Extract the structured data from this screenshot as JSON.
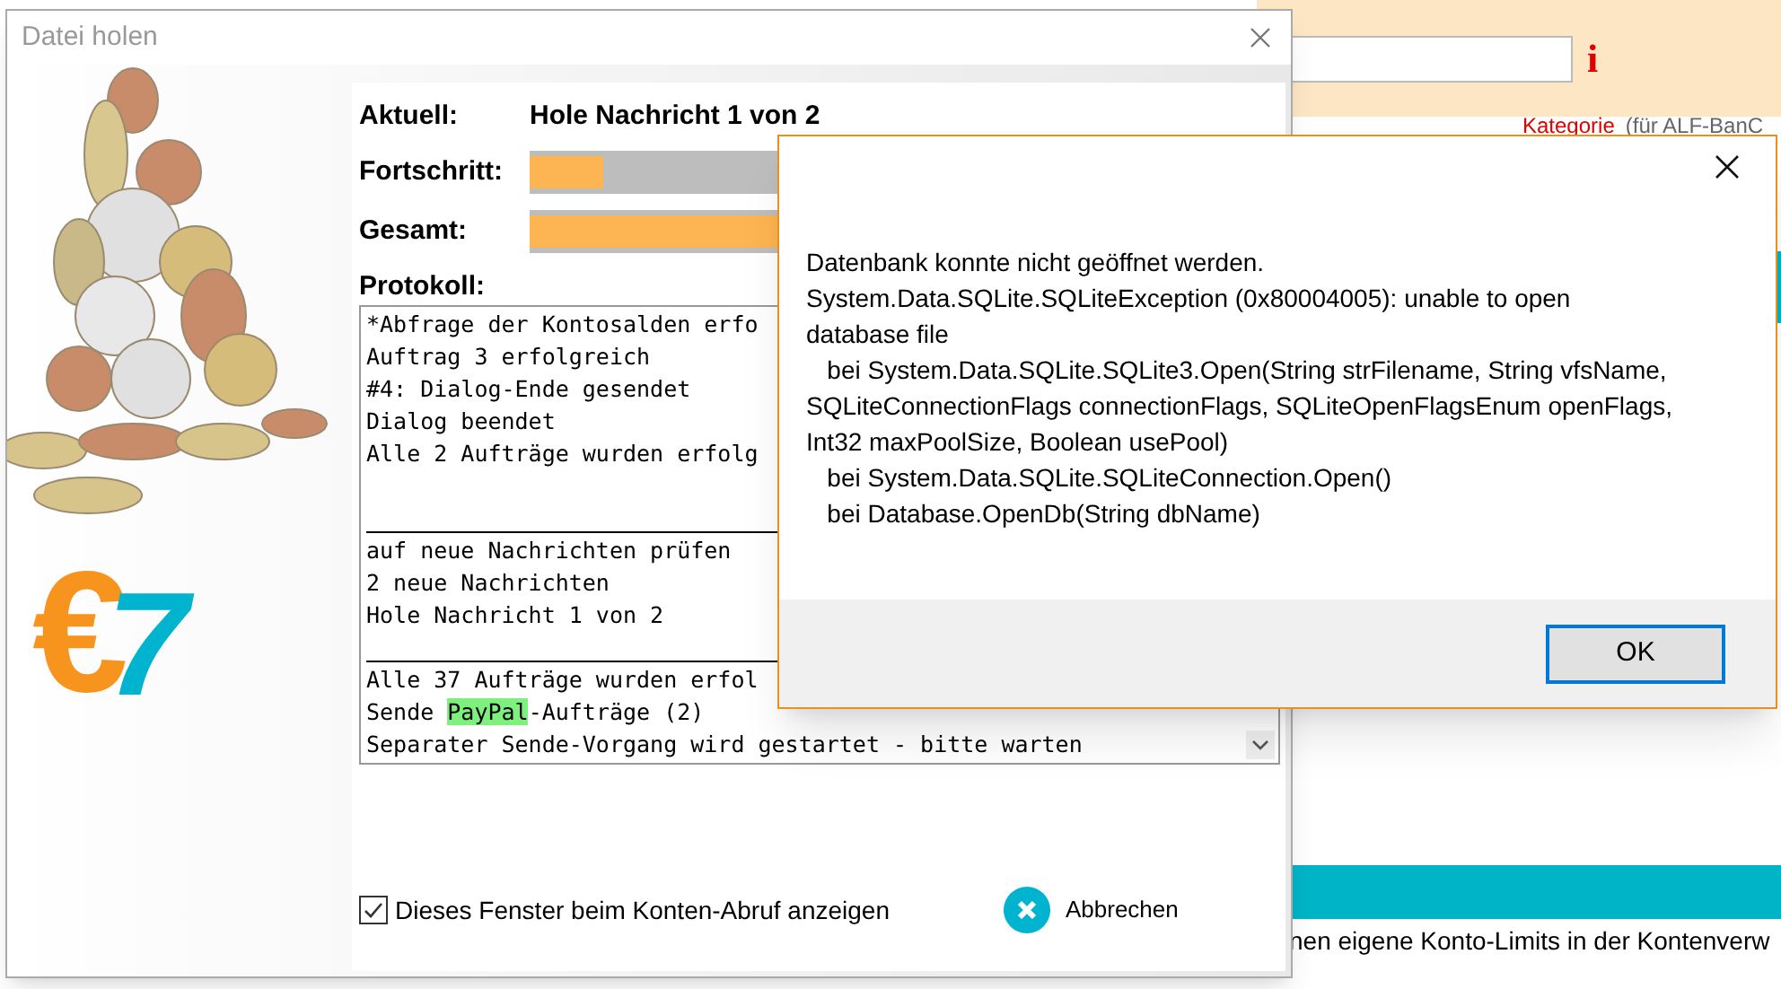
{
  "background_app": {
    "category_link": "Kategorie",
    "category_note": "(für ALF-BanC",
    "footer_text": "nen eigene Konto-Limits in der Kontenverw",
    "info_mark": "i"
  },
  "transfer_dialog": {
    "title": "Datei holen",
    "logo": {
      "symbol": "€",
      "digit": "7"
    },
    "current_label": "Aktuell:",
    "current_value": "Hole Nachricht 1 von 2",
    "progress": [
      {
        "label": "Fortschritt:",
        "level": 0.1
      },
      {
        "label": "Gesamt:",
        "level": 1
      }
    ],
    "log_label": "Protokoll:",
    "log": [
      {
        "kind": "line",
        "segments": [
          {
            "text": "*Abfrage der Kontosalden erfo",
            "highlight": false
          }
        ]
      },
      {
        "kind": "line",
        "segments": [
          {
            "text": "Auftrag 3 erfolgreich",
            "highlight": false
          }
        ]
      },
      {
        "kind": "line",
        "segments": [
          {
            "text": "#4: Dialog-Ende gesendet",
            "highlight": false
          }
        ]
      },
      {
        "kind": "line",
        "segments": [
          {
            "text": "Dialog beendet",
            "highlight": false
          }
        ]
      },
      {
        "kind": "line",
        "segments": [
          {
            "text": "Alle 2 Aufträge wurden erfolg",
            "highlight": false
          }
        ]
      },
      {
        "kind": "blank"
      },
      {
        "kind": "rule"
      },
      {
        "kind": "line",
        "segments": [
          {
            "text": "auf neue Nachrichten prüfen",
            "highlight": false
          }
        ]
      },
      {
        "kind": "line",
        "segments": [
          {
            "text": "2 neue Nachrichten",
            "highlight": false
          }
        ]
      },
      {
        "kind": "line",
        "segments": [
          {
            "text": "Hole Nachricht 1 von 2",
            "highlight": false
          }
        ]
      },
      {
        "kind": "rule"
      },
      {
        "kind": "line",
        "segments": [
          {
            "text": "Alle 37 Aufträge wurden erfol",
            "highlight": false
          }
        ]
      },
      {
        "kind": "line",
        "segments": [
          {
            "text": "Sende ",
            "highlight": false
          },
          {
            "text": "PayPal",
            "highlight": true
          },
          {
            "text": "-Aufträge (2)",
            "highlight": false
          }
        ]
      },
      {
        "kind": "line",
        "segments": [
          {
            "text": "Separater Sende-Vorgang wird gestartet - bitte warten",
            "highlight": false
          }
        ]
      }
    ],
    "show_window": {
      "label": "Dieses Fenster beim Konten-Abruf anzeigen",
      "checked": true
    },
    "cancel_button": "Abbrechen"
  },
  "error_dialog": {
    "message": [
      "Datenbank konnte nicht geöffnet werden.",
      "System.Data.SQLite.SQLiteException (0x80004005): unable to open",
      "database file",
      "   bei System.Data.SQLite.SQLite3.Open(String strFilename, String vfsName,",
      "SQLiteConnectionFlags connectionFlags, SQLiteOpenFlagsEnum openFlags,",
      "Int32 maxPoolSize, Boolean usePool)",
      "   bei System.Data.SQLite.SQLiteConnection.Open()",
      "   bei Database.OpenDb(String dbName)"
    ],
    "ok_button": "OK"
  }
}
